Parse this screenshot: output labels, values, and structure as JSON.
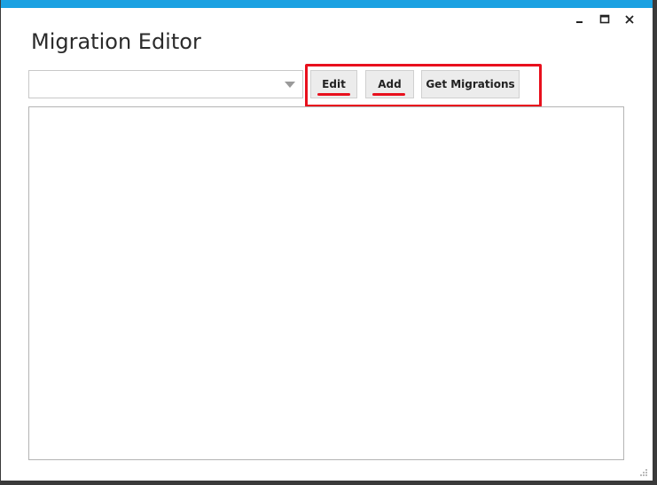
{
  "window": {
    "title": "Migration Editor",
    "accent_color": "#1ba1e2",
    "caption_buttons": [
      "minimize-icon",
      "maximize-icon",
      "close-icon"
    ]
  },
  "toolbar": {
    "combo_value": "",
    "edit_label": "Edit",
    "add_label": "Add",
    "get_migrations_label": "Get Migrations"
  },
  "annotation": {
    "highlight_color": "#e8101d"
  }
}
